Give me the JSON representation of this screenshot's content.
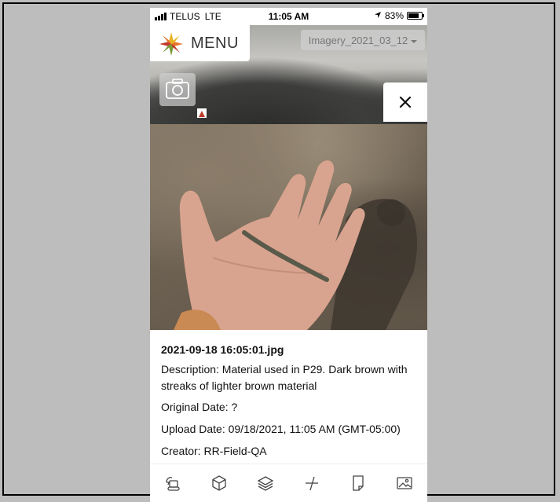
{
  "status_bar": {
    "carrier": "TELUS",
    "network": "LTE",
    "time": "11:05 AM",
    "battery": "83%",
    "battery_level": 0.83
  },
  "map_header": {
    "menu_label": "MENU",
    "imagery_label": "Imagery_2021_03_12"
  },
  "photo_detail": {
    "filename": "2021-09-18 16:05:01.jpg",
    "description": "Description: Material used in P29. Dark brown with streaks of lighter brown material",
    "original_date": "Original Date: ?",
    "upload_date": "Upload Date: 09/18/2021, 11:05 AM (GMT-05:00)",
    "creator": "Creator: RR-Field-QA"
  },
  "toolbar": {
    "items": [
      "excavator-icon",
      "cube-icon",
      "layers-icon",
      "measure-icon",
      "document-icon",
      "image-icon"
    ]
  },
  "colors": {
    "logo_orange": "#e8762b",
    "logo_gold": "#e6b422",
    "logo_green": "#7a9a3a",
    "logo_red": "#c0392b"
  }
}
